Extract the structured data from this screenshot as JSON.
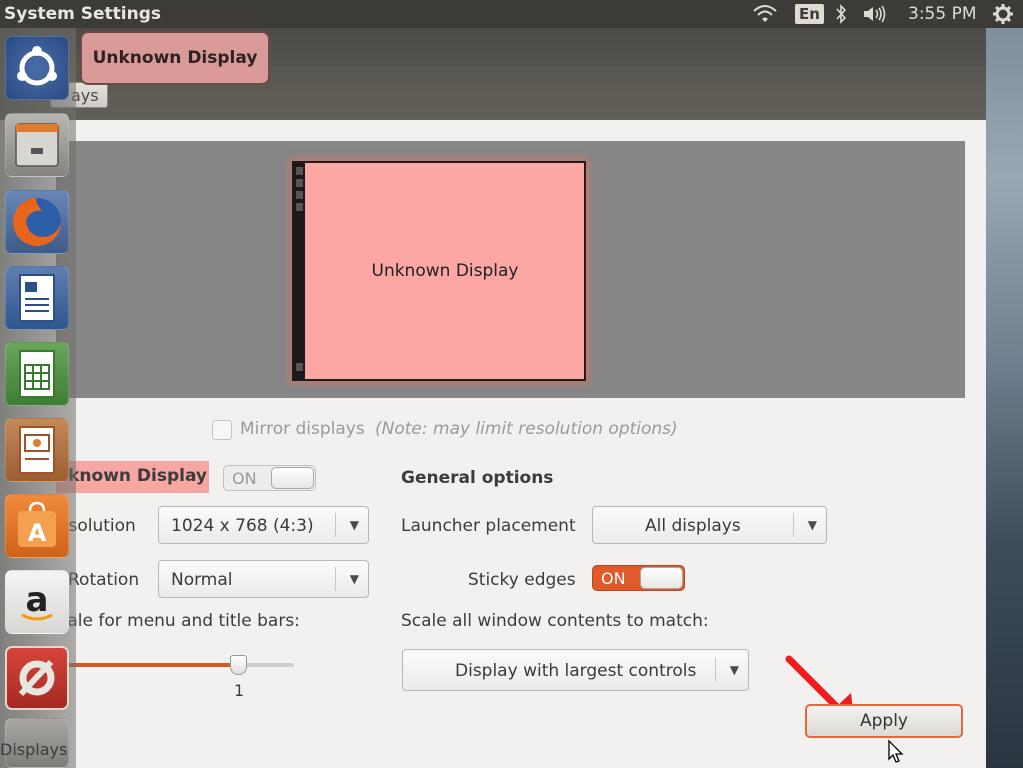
{
  "top_panel": {
    "app_title": "System Settings",
    "language": "En",
    "time": "3:55 PM",
    "icons": [
      "wifi-icon",
      "bluetooth-icon",
      "volume-icon",
      "gear-icon"
    ]
  },
  "header": {
    "back_label": "ays",
    "display_badge": "Unknown Display"
  },
  "monitor": {
    "label": "Unknown Display"
  },
  "mirror": {
    "label": "Mirror displays",
    "note": "(Note: may limit resolution options)",
    "checked": false
  },
  "display_section": {
    "name": "nknown Display",
    "switch_label": "ON",
    "resolution_label": "esolution",
    "resolution_value": "1024 x 768 (4:3)",
    "rotation_label": "Rotation",
    "rotation_value": "Normal",
    "scale_label": "cale for menu and title bars:",
    "scale_value": "1"
  },
  "general": {
    "title": "General options",
    "launcher_label": "Launcher placement",
    "launcher_value": "All displays",
    "sticky_label": "Sticky edges",
    "sticky_switch": "ON",
    "scale_all_label": "Scale all window contents to match:",
    "scale_all_value": "Display with largest controls"
  },
  "footer": {
    "apply_label": "Apply",
    "launcher_tooltip": "Displays"
  },
  "launcher": {
    "items": [
      "ubuntu-dash-icon",
      "files-icon",
      "firefox-icon",
      "writer-icon",
      "calc-icon",
      "impress-icon",
      "software-center-icon",
      "amazon-icon",
      "system-settings-icon",
      "trash-icon"
    ]
  },
  "colors": {
    "accent": "#e05a2b",
    "display_highlight": "#fca7a4"
  }
}
